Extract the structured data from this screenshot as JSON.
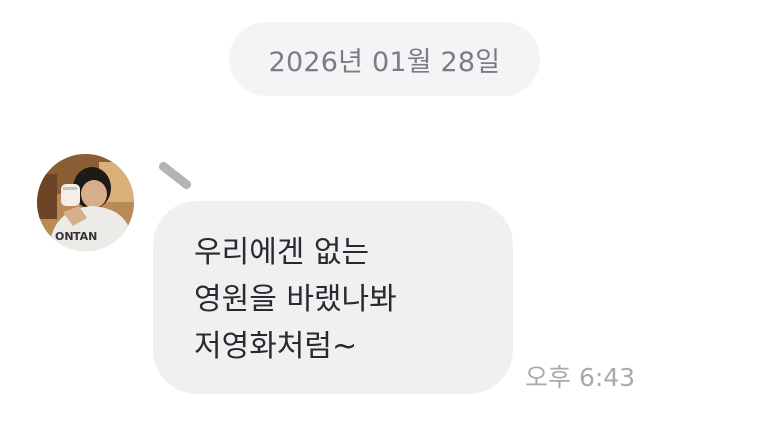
{
  "date_divider": {
    "label": "2026년 01월 28일"
  },
  "message": {
    "avatar_icon": "profile-photo-icon",
    "lines": [
      "우리에겐 없는",
      "영원을 바랬나봐",
      "저영화처럼~"
    ],
    "time": "오후 6:43"
  },
  "colors": {
    "background": "#ffffff",
    "date_pill": "#f4f4f6",
    "bubble": "#f0f0f2",
    "text": "#2a2a2e",
    "meta_text": "#a9a9ae"
  }
}
